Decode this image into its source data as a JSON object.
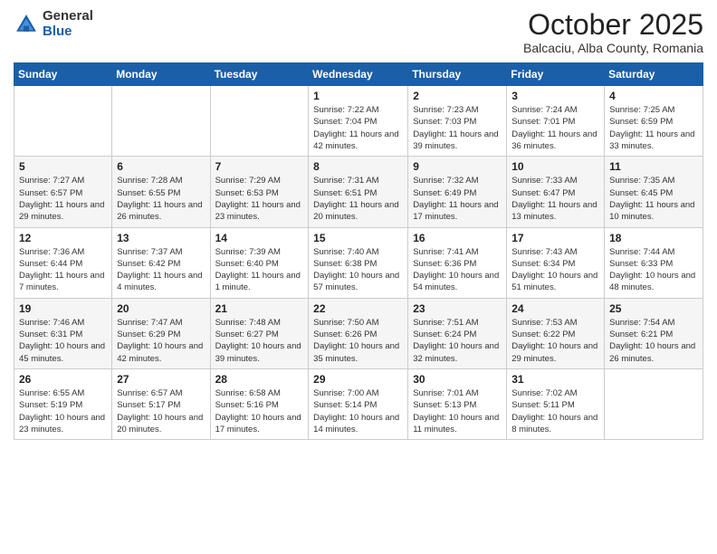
{
  "logo": {
    "general": "General",
    "blue": "Blue"
  },
  "header": {
    "month": "October 2025",
    "location": "Balcaciu, Alba County, Romania"
  },
  "days_of_week": [
    "Sunday",
    "Monday",
    "Tuesday",
    "Wednesday",
    "Thursday",
    "Friday",
    "Saturday"
  ],
  "weeks": [
    [
      {
        "day": "",
        "info": ""
      },
      {
        "day": "",
        "info": ""
      },
      {
        "day": "",
        "info": ""
      },
      {
        "day": "1",
        "info": "Sunrise: 7:22 AM\nSunset: 7:04 PM\nDaylight: 11 hours and 42 minutes."
      },
      {
        "day": "2",
        "info": "Sunrise: 7:23 AM\nSunset: 7:03 PM\nDaylight: 11 hours and 39 minutes."
      },
      {
        "day": "3",
        "info": "Sunrise: 7:24 AM\nSunset: 7:01 PM\nDaylight: 11 hours and 36 minutes."
      },
      {
        "day": "4",
        "info": "Sunrise: 7:25 AM\nSunset: 6:59 PM\nDaylight: 11 hours and 33 minutes."
      }
    ],
    [
      {
        "day": "5",
        "info": "Sunrise: 7:27 AM\nSunset: 6:57 PM\nDaylight: 11 hours and 29 minutes."
      },
      {
        "day": "6",
        "info": "Sunrise: 7:28 AM\nSunset: 6:55 PM\nDaylight: 11 hours and 26 minutes."
      },
      {
        "day": "7",
        "info": "Sunrise: 7:29 AM\nSunset: 6:53 PM\nDaylight: 11 hours and 23 minutes."
      },
      {
        "day": "8",
        "info": "Sunrise: 7:31 AM\nSunset: 6:51 PM\nDaylight: 11 hours and 20 minutes."
      },
      {
        "day": "9",
        "info": "Sunrise: 7:32 AM\nSunset: 6:49 PM\nDaylight: 11 hours and 17 minutes."
      },
      {
        "day": "10",
        "info": "Sunrise: 7:33 AM\nSunset: 6:47 PM\nDaylight: 11 hours and 13 minutes."
      },
      {
        "day": "11",
        "info": "Sunrise: 7:35 AM\nSunset: 6:45 PM\nDaylight: 11 hours and 10 minutes."
      }
    ],
    [
      {
        "day": "12",
        "info": "Sunrise: 7:36 AM\nSunset: 6:44 PM\nDaylight: 11 hours and 7 minutes."
      },
      {
        "day": "13",
        "info": "Sunrise: 7:37 AM\nSunset: 6:42 PM\nDaylight: 11 hours and 4 minutes."
      },
      {
        "day": "14",
        "info": "Sunrise: 7:39 AM\nSunset: 6:40 PM\nDaylight: 11 hours and 1 minute."
      },
      {
        "day": "15",
        "info": "Sunrise: 7:40 AM\nSunset: 6:38 PM\nDaylight: 10 hours and 57 minutes."
      },
      {
        "day": "16",
        "info": "Sunrise: 7:41 AM\nSunset: 6:36 PM\nDaylight: 10 hours and 54 minutes."
      },
      {
        "day": "17",
        "info": "Sunrise: 7:43 AM\nSunset: 6:34 PM\nDaylight: 10 hours and 51 minutes."
      },
      {
        "day": "18",
        "info": "Sunrise: 7:44 AM\nSunset: 6:33 PM\nDaylight: 10 hours and 48 minutes."
      }
    ],
    [
      {
        "day": "19",
        "info": "Sunrise: 7:46 AM\nSunset: 6:31 PM\nDaylight: 10 hours and 45 minutes."
      },
      {
        "day": "20",
        "info": "Sunrise: 7:47 AM\nSunset: 6:29 PM\nDaylight: 10 hours and 42 minutes."
      },
      {
        "day": "21",
        "info": "Sunrise: 7:48 AM\nSunset: 6:27 PM\nDaylight: 10 hours and 39 minutes."
      },
      {
        "day": "22",
        "info": "Sunrise: 7:50 AM\nSunset: 6:26 PM\nDaylight: 10 hours and 35 minutes."
      },
      {
        "day": "23",
        "info": "Sunrise: 7:51 AM\nSunset: 6:24 PM\nDaylight: 10 hours and 32 minutes."
      },
      {
        "day": "24",
        "info": "Sunrise: 7:53 AM\nSunset: 6:22 PM\nDaylight: 10 hours and 29 minutes."
      },
      {
        "day": "25",
        "info": "Sunrise: 7:54 AM\nSunset: 6:21 PM\nDaylight: 10 hours and 26 minutes."
      }
    ],
    [
      {
        "day": "26",
        "info": "Sunrise: 6:55 AM\nSunset: 5:19 PM\nDaylight: 10 hours and 23 minutes."
      },
      {
        "day": "27",
        "info": "Sunrise: 6:57 AM\nSunset: 5:17 PM\nDaylight: 10 hours and 20 minutes."
      },
      {
        "day": "28",
        "info": "Sunrise: 6:58 AM\nSunset: 5:16 PM\nDaylight: 10 hours and 17 minutes."
      },
      {
        "day": "29",
        "info": "Sunrise: 7:00 AM\nSunset: 5:14 PM\nDaylight: 10 hours and 14 minutes."
      },
      {
        "day": "30",
        "info": "Sunrise: 7:01 AM\nSunset: 5:13 PM\nDaylight: 10 hours and 11 minutes."
      },
      {
        "day": "31",
        "info": "Sunrise: 7:02 AM\nSunset: 5:11 PM\nDaylight: 10 hours and 8 minutes."
      },
      {
        "day": "",
        "info": ""
      }
    ]
  ]
}
